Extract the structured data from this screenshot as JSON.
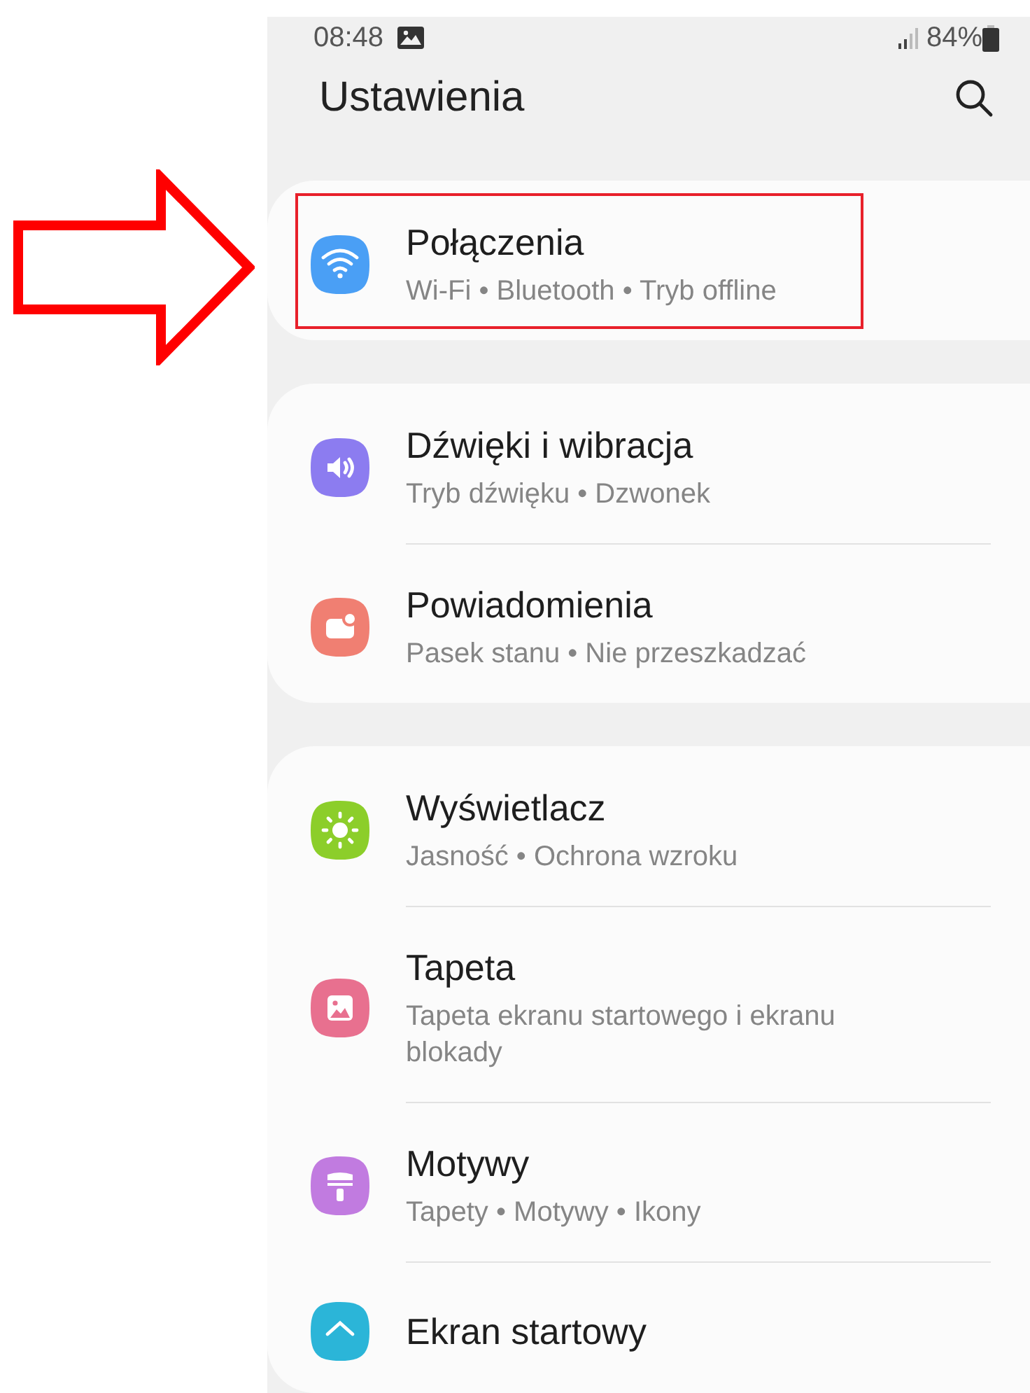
{
  "status_bar": {
    "time": "08:48",
    "battery": "84%"
  },
  "header": {
    "title": "Ustawienia"
  },
  "groups": [
    {
      "items": [
        {
          "kind": "wifi",
          "color": "#4a9ff5",
          "title": "Połączenia",
          "subtitle": "Wi-Fi • Bluetooth • Tryb offline",
          "highlighted": true
        }
      ]
    },
    {
      "items": [
        {
          "kind": "sound",
          "color": "#8c7cf0",
          "title": "Dźwięki i wibracja",
          "subtitle": "Tryb dźwięku • Dzwonek",
          "highlighted": false
        },
        {
          "kind": "notification",
          "color": "#f07f72",
          "title": "Powiadomienia",
          "subtitle": "Pasek stanu • Nie przeszkadzać",
          "highlighted": false
        }
      ]
    },
    {
      "items": [
        {
          "kind": "display",
          "color": "#8cce2a",
          "title": "Wyświetlacz",
          "subtitle": "Jasność • Ochrona wzroku",
          "highlighted": false
        },
        {
          "kind": "wallpaper",
          "color": "#e8708f",
          "title": "Tapeta",
          "subtitle": "Tapeta ekranu startowego i ekranu blokady",
          "highlighted": false
        },
        {
          "kind": "theme",
          "color": "#c17be0",
          "title": "Motywy",
          "subtitle": "Tapety • Motywy • Ikony",
          "highlighted": false
        },
        {
          "kind": "home",
          "color": "#2bb5d8",
          "title": "Ekran startowy",
          "highlighted": false
        }
      ]
    }
  ]
}
